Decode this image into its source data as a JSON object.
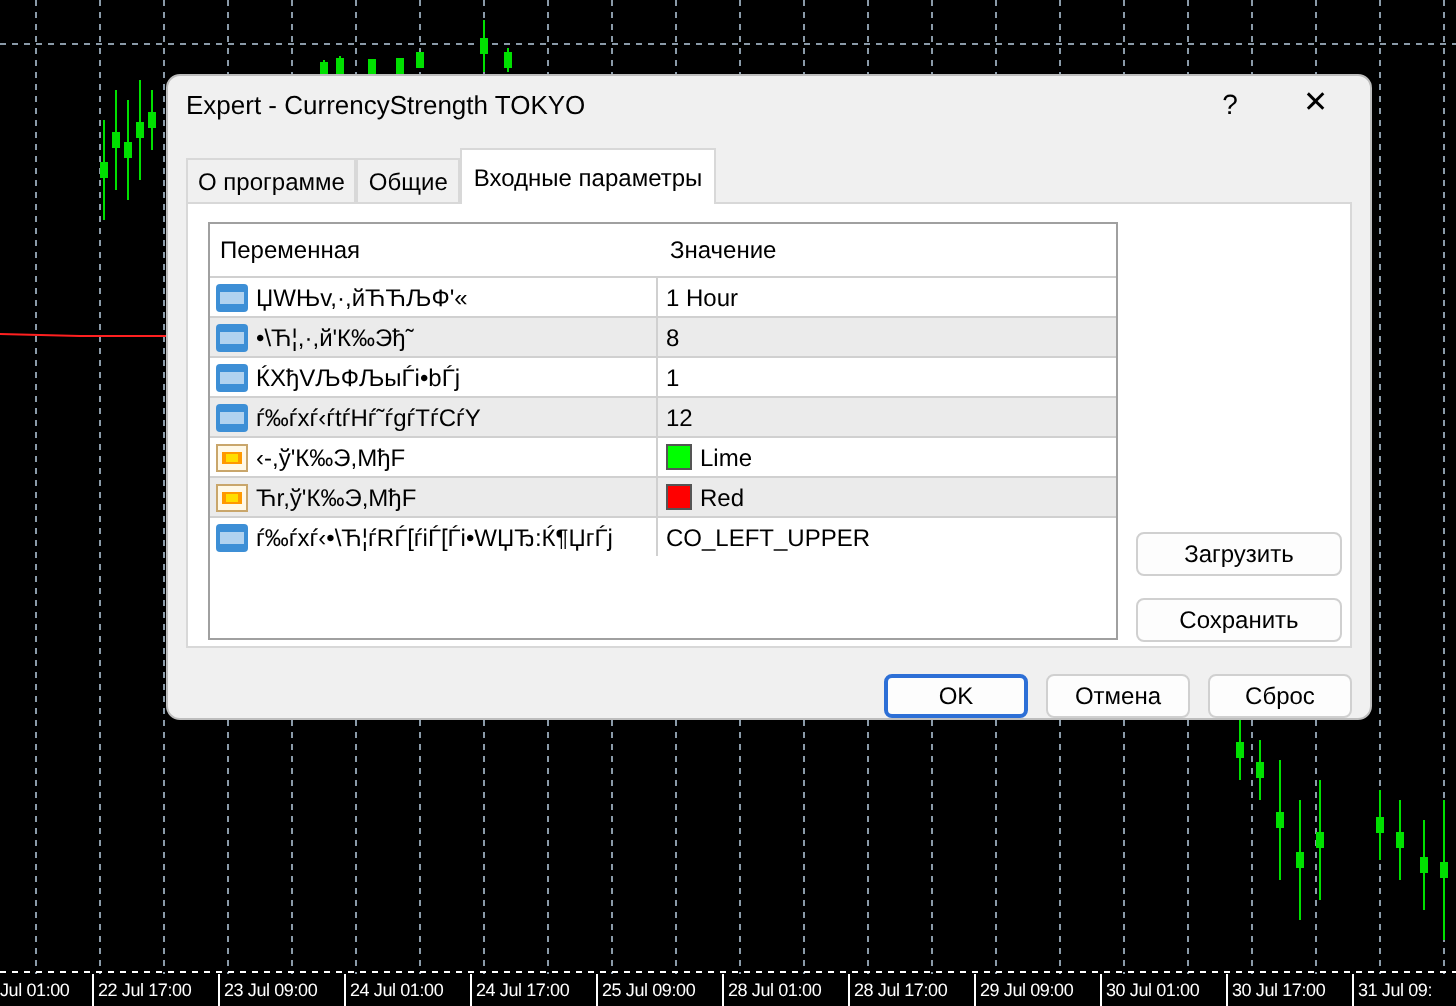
{
  "dialog": {
    "title": "Expert - CurrencyStrength TOKYO",
    "help": "?",
    "close": "✕"
  },
  "tabs": [
    {
      "label": "О программе",
      "selected": false
    },
    {
      "label": "Общие",
      "selected": false
    },
    {
      "label": "Входные параметры",
      "selected": true
    }
  ],
  "table": {
    "columns": [
      "Переменная",
      "Значение"
    ],
    "rows": [
      {
        "kind": "number",
        "name": "ЏWЊv,·,йЋЋЉФ'«",
        "value": "1 Hour"
      },
      {
        "kind": "number",
        "name": "•\\Ћ¦,·,й'К‰Эђ˜",
        "value": "8"
      },
      {
        "kind": "number",
        "name": "ЌXђVЉФЉыЃі•bЃј",
        "value": "1"
      },
      {
        "kind": "number",
        "name": "ѓ‰ѓxѓ‹ѓtѓHѓ˜ѓgѓTѓCѓY",
        "value": "12"
      },
      {
        "kind": "color",
        "name": "‹-,ў'К‰Э,MђF",
        "value": "Lime",
        "color": "#00ff00"
      },
      {
        "kind": "color",
        "name": "Ћr,ў'К‰Э,MђF",
        "value": "Red",
        "color": "#ff0000"
      },
      {
        "kind": "number",
        "name": "ѓ‰ѓxѓ‹•\\Ћ¦ѓRЃ[ѓiЃ[Ѓі•WЏЂ:Ќ¶ЏгЃј",
        "value": "CO_LEFT_UPPER"
      }
    ]
  },
  "side_buttons": [
    "Загрузить",
    "Сохранить"
  ],
  "buttons": [
    {
      "label": "OK",
      "default": true
    },
    {
      "label": "Отмена",
      "default": false
    },
    {
      "label": "Сброс",
      "default": false
    }
  ],
  "time_axis": [
    "Jul 01:00",
    "22 Jul 17:00",
    "23 Jul 09:00",
    "24 Jul 01:00",
    "24 Jul 17:00",
    "25 Jul 09:00",
    "28 Jul 01:00",
    "28 Jul 17:00",
    "29 Jul 09:00",
    "30 Jul 01:00",
    "30 Jul 17:00",
    "31 Jul 09:"
  ]
}
